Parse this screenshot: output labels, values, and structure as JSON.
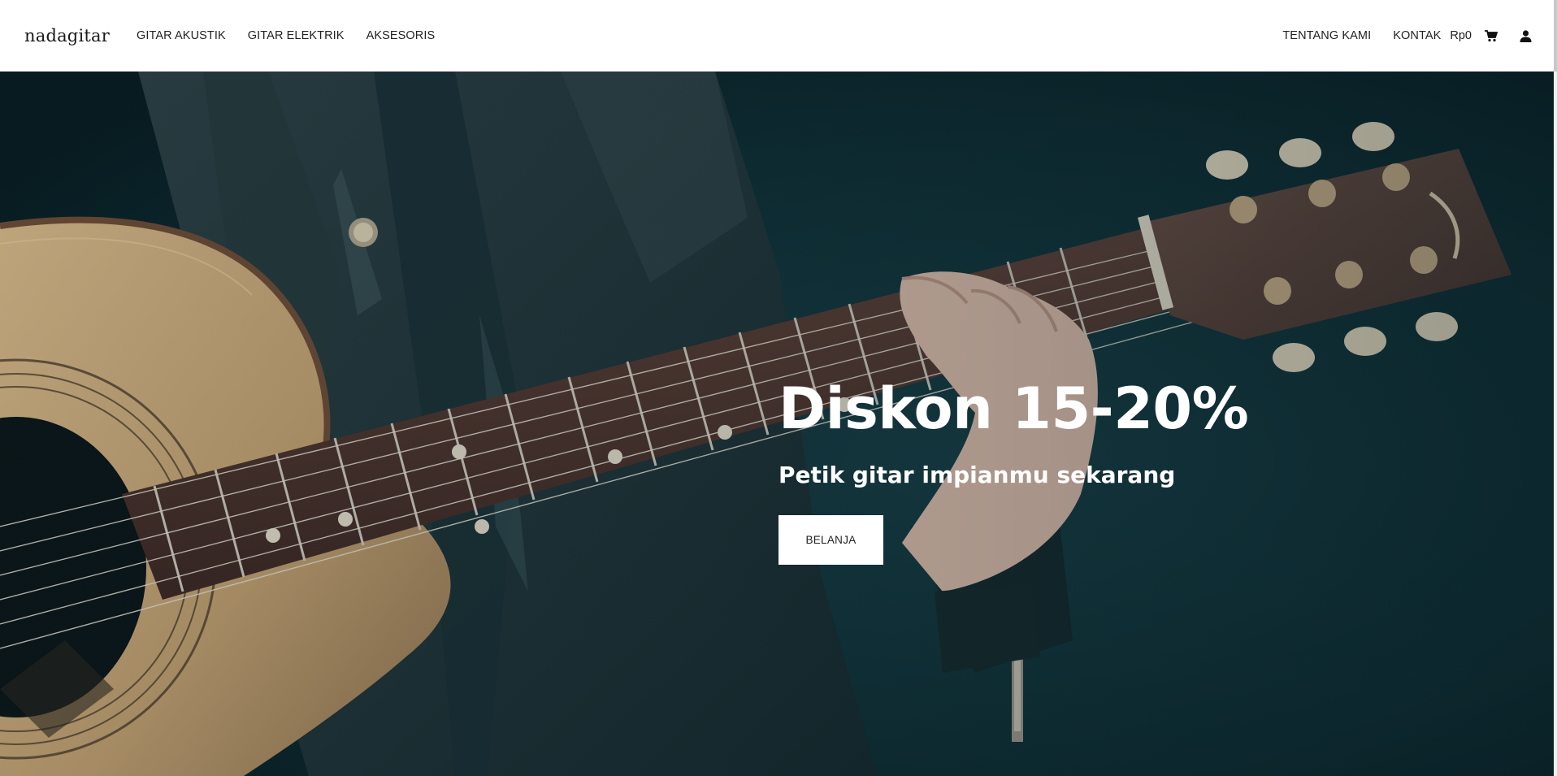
{
  "brand": {
    "logo_text": "nadagitar"
  },
  "nav": {
    "left": [
      {
        "label": "GITAR AKUSTIK"
      },
      {
        "label": "GITAR ELEKTRIK"
      },
      {
        "label": "AKSESORIS"
      }
    ],
    "right": [
      {
        "label": "TENTANG KAMI"
      },
      {
        "label": "KONTAK"
      }
    ],
    "cart_total": "Rp0",
    "icons": [
      "cart-icon",
      "user-icon"
    ]
  },
  "hero": {
    "title": "Diskon 15-20%",
    "subtitle": "Petik gitar impianmu sekarang",
    "cta_label": "BELANJA",
    "background_image": "guitar-player-photo",
    "colors": {
      "background": "#0f2a30",
      "text": "#ffffff",
      "button_bg": "#ffffff",
      "button_text": "#222222"
    }
  },
  "colors": {
    "header_bg": "#ffffff",
    "nav_text": "#222222"
  }
}
